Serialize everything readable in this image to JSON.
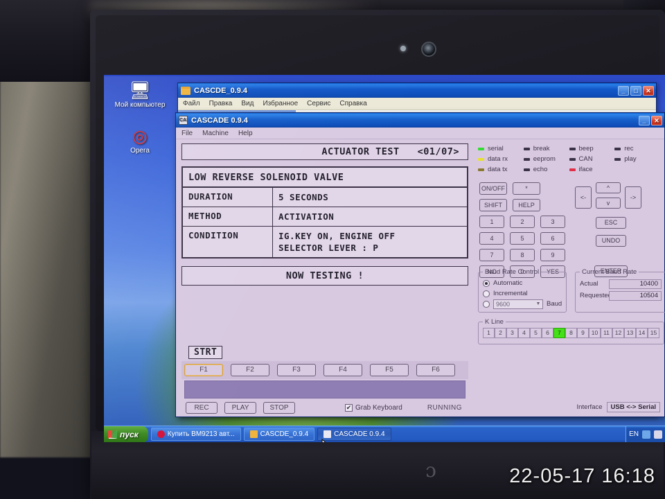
{
  "photo": {
    "timestamp": "22-05-17 16:18"
  },
  "desktop": {
    "icons": [
      {
        "name": "my-computer",
        "label": "Мой компьютер",
        "glyph": "🖥"
      },
      {
        "name": "opera",
        "label": "Opera",
        "glyph": "◎"
      }
    ]
  },
  "taskbar": {
    "start_label": "пуск",
    "items": [
      {
        "name": "browser",
        "label": "Купить BM9213 авт...",
        "active": false
      },
      {
        "name": "explorer",
        "label": "CASCDE_0.9.4",
        "active": false
      },
      {
        "name": "cascade",
        "label": "CASCADE 0.9.4",
        "active": true
      }
    ],
    "language": "EN"
  },
  "explorer_window": {
    "title": "CASCDE_0.9.4",
    "menu": [
      "Файл",
      "Правка",
      "Вид",
      "Избранное",
      "Сервис",
      "Справка"
    ],
    "buttons": {
      "minimize": "_",
      "maximize": "□",
      "close": "✕"
    }
  },
  "cascade_window": {
    "title": "CASCADE 0.9.4",
    "icon_text": "CAS",
    "menu": [
      "File",
      "Machine",
      "Help"
    ],
    "buttons": {
      "minimize": "_",
      "close": "✕"
    }
  },
  "ecu_display": {
    "header_title": "ACTUATOR TEST",
    "header_page": "<01/07>",
    "item_name": "LOW REVERSE SOLENOID VALVE",
    "rows": [
      {
        "key": "DURATION",
        "value": [
          "5 SECONDS"
        ]
      },
      {
        "key": "METHOD",
        "value": [
          "ACTIVATION"
        ]
      },
      {
        "key": "CONDITION",
        "value": [
          "IG.KEY ON, ENGINE OFF",
          "SELECTOR LEVER : P"
        ]
      }
    ],
    "status_message": "NOW TESTING !",
    "softkey_label": "STRT"
  },
  "function_keys": [
    {
      "label": "F1",
      "focused": true
    },
    {
      "label": "F2",
      "focused": false
    },
    {
      "label": "F3",
      "focused": false
    },
    {
      "label": "F4",
      "focused": false
    },
    {
      "label": "F5",
      "focused": false
    },
    {
      "label": "F6",
      "focused": false
    }
  ],
  "transport_controls": {
    "rec_label": "REC",
    "play_label": "PLAY",
    "stop_label": "STOP",
    "grab_keyboard_label": "Grab Keyboard",
    "grab_keyboard_checked": "✔",
    "run_state": "RUNNING"
  },
  "leds": {
    "columns": [
      [
        {
          "label": "serial",
          "color": "#33dd33"
        },
        {
          "label": "data rx",
          "color": "#e8e030"
        },
        {
          "label": "data tx",
          "color": "#8a7a30"
        }
      ],
      [
        {
          "label": "break",
          "color": "#3a3348"
        },
        {
          "label": "eeprom",
          "color": "#3a3348"
        },
        {
          "label": "echo",
          "color": "#3a3348"
        }
      ],
      [
        {
          "label": "beep",
          "color": "#3a3348"
        },
        {
          "label": "CAN",
          "color": "#3a3348"
        },
        {
          "label": "iface",
          "color": "#e03048"
        }
      ],
      [
        {
          "label": "rec",
          "color": "#3a3348"
        },
        {
          "label": "play",
          "color": "#3a3348"
        }
      ]
    ]
  },
  "keypad": {
    "rows": [
      [
        "ON/OFF",
        "*"
      ],
      [
        "SHIFT",
        "HELP"
      ],
      [
        "1",
        "2",
        "3"
      ],
      [
        "4",
        "5",
        "6"
      ],
      [
        "7",
        "8",
        "9"
      ],
      [
        "NO",
        "0",
        "YES"
      ]
    ]
  },
  "navpad": {
    "left": "<-",
    "up": "^",
    "down": "v",
    "right": "->",
    "esc": "ESC",
    "undo": "UNDO",
    "enter": "ENTER"
  },
  "baud_control": {
    "legend": "Baud Rate Control",
    "automatic_label": "Automatic",
    "automatic_selected": true,
    "incremental_label": "Incremental",
    "manual_selected": false,
    "manual_value": "9600",
    "baud_label": "Baud"
  },
  "current_baud": {
    "legend": "Current Baud Rate",
    "actual_label": "Actual",
    "actual_value": "10400",
    "requested_label": "Requested",
    "requested_value": "10504"
  },
  "k_line": {
    "legend": "K Line",
    "cells": [
      "1",
      "2",
      "3",
      "4",
      "5",
      "6",
      "7",
      "8",
      "9",
      "10",
      "11",
      "12",
      "13",
      "14",
      "15"
    ],
    "active": "7",
    "active_color": "#44e018"
  },
  "interface": {
    "label": "Interface",
    "value": "USB <-> Serial"
  }
}
